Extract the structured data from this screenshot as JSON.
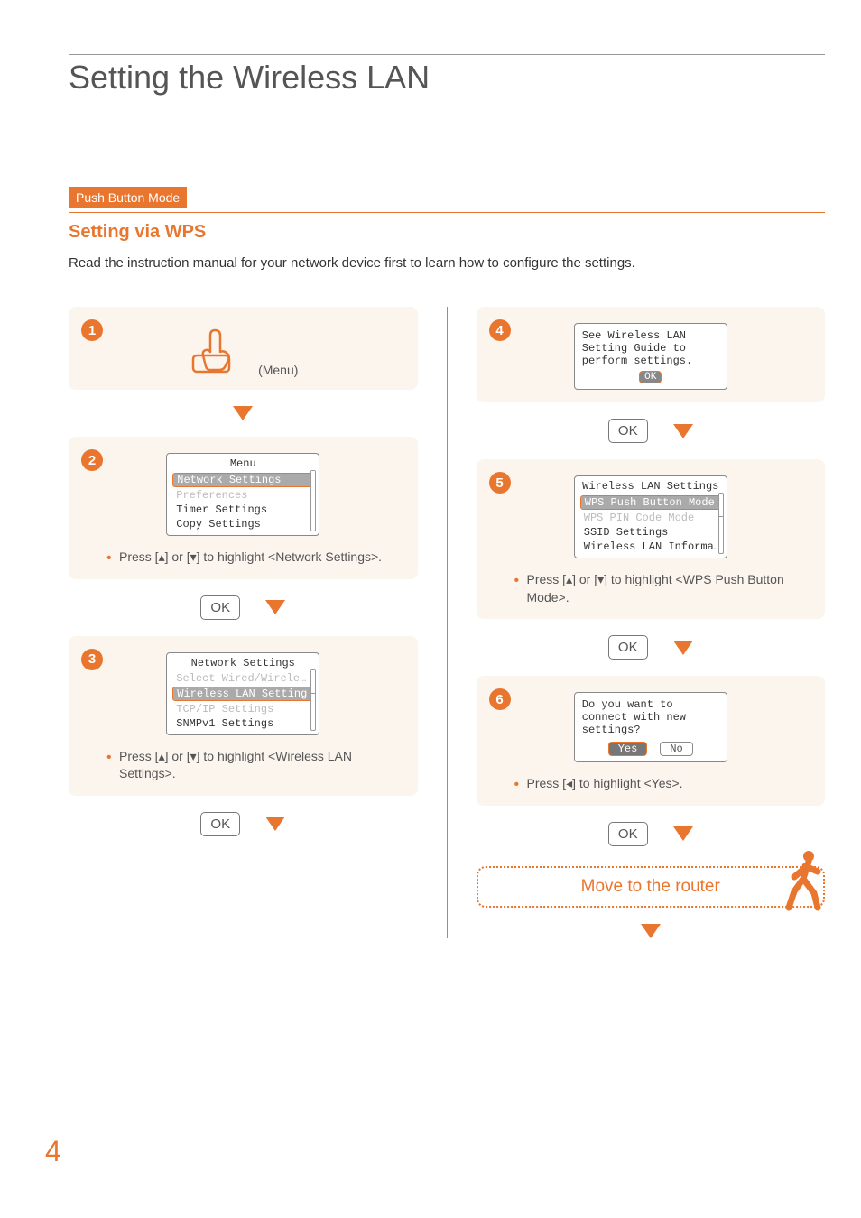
{
  "page_title": "Setting the Wireless LAN",
  "tag": "Push Button Mode",
  "subtitle": "Setting via WPS",
  "intro": "Read the instruction manual for your network device first to learn how to configure the settings.",
  "page_number": "4",
  "ok_label": "OK",
  "router_banner": "Move to the router",
  "steps": {
    "s1": {
      "num": "1",
      "menu_label": "(Menu)"
    },
    "s2": {
      "num": "2",
      "lcd_title": "Menu",
      "items": [
        "Network Settings",
        "Preferences",
        "Timer Settings",
        "Copy Settings"
      ],
      "highlight_index": 0,
      "bullet": "Press [▴] or [▾] to highlight <Network Settings>."
    },
    "s3": {
      "num": "3",
      "lcd_title": "Network Settings",
      "items": [
        "Select Wired/Wirele…",
        "Wireless LAN Setting",
        "TCP/IP Settings",
        "SNMPv1 Settings"
      ],
      "highlight_index": 1,
      "bullet": "Press [▴] or [▾] to highlight <Wireless LAN Settings>."
    },
    "s4": {
      "num": "4",
      "lines": [
        "See Wireless LAN",
        "Setting Guide to",
        "perform settings."
      ],
      "ok": "OK"
    },
    "s5": {
      "num": "5",
      "lcd_title": "Wireless LAN Settings",
      "items": [
        "WPS Push Button Mode",
        "WPS PIN Code Mode",
        "SSID Settings",
        "Wireless LAN Informa…"
      ],
      "highlight_index": 0,
      "bullet": "Press [▴] or [▾] to highlight <WPS Push Button Mode>."
    },
    "s6": {
      "num": "6",
      "lines": [
        "Do you want to",
        "connect with new",
        "settings?"
      ],
      "yes": "Yes",
      "no": "No",
      "bullet": "Press [◂] to highlight <Yes>."
    }
  }
}
